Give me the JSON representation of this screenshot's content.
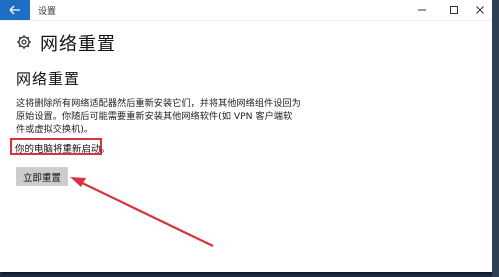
{
  "window": {
    "title": "设置"
  },
  "header": {
    "title": "网络重置",
    "icon": "gear-icon"
  },
  "section": {
    "title": "网络重置",
    "description": "这将删除所有网络适配器然后重新安装它们，并将其他网络组件设回为原始设置。你随后可能需要重新安装其他网络软件(如 VPN 客户端软件或虚拟交换机)。",
    "restart_note": "你的电脑将重新启动。",
    "reset_button": "立即重置"
  },
  "colors": {
    "accent": "#1e6ec6",
    "annotation": "#d9333f",
    "button_bg": "#cccccc"
  }
}
